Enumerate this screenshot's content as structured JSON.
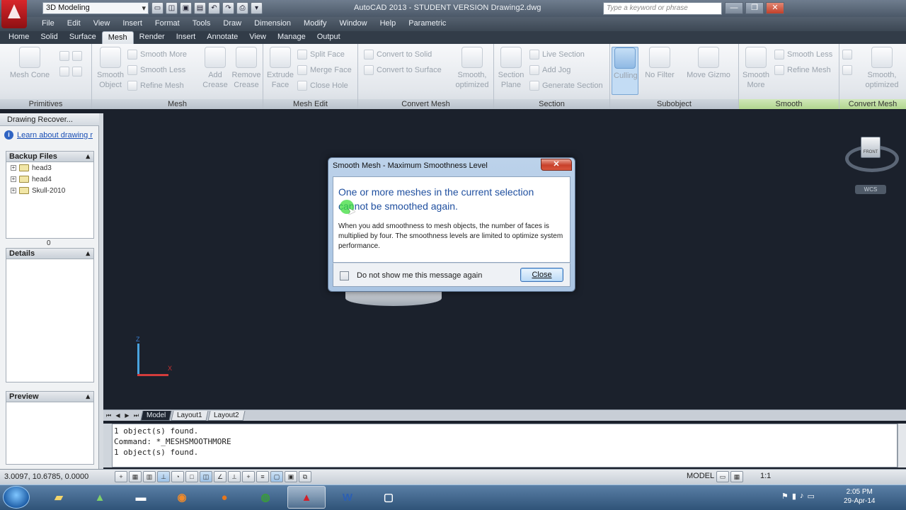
{
  "titlebar": {
    "workspace": "3D Modeling",
    "title": "AutoCAD 2013 - STUDENT VERSION   Drawing2.dwg",
    "search_placeholder": "Type a keyword or phrase",
    "min": "—",
    "max": "❐",
    "close": "✕"
  },
  "menu": [
    "File",
    "Edit",
    "View",
    "Insert",
    "Format",
    "Tools",
    "Draw",
    "Dimension",
    "Modify",
    "Window",
    "Help",
    "Parametric"
  ],
  "tabs": [
    "Home",
    "Solid",
    "Surface",
    "Mesh",
    "Render",
    "Insert",
    "Annotate",
    "View",
    "Manage",
    "Output"
  ],
  "active_tab": "Mesh",
  "ribbon": {
    "primitives": {
      "title": "Primitives",
      "mesh_cone": "Mesh Cone"
    },
    "mesh": {
      "title": "Mesh",
      "smooth_object": "Smooth Object",
      "smooth_more": "Smooth More",
      "smooth_less": "Smooth Less",
      "refine_mesh": "Refine Mesh"
    },
    "mesh_edit": {
      "title": "Mesh Edit",
      "add_crease": "Add Crease",
      "remove_crease": "Remove Crease",
      "extrude_face": "Extrude Face",
      "split_face": "Split Face",
      "merge_face": "Merge Face",
      "close_hole": "Close Hole"
    },
    "convert_mesh": {
      "title": "Convert Mesh",
      "convert_solid": "Convert to Solid",
      "convert_surface": "Convert to Surface",
      "smooth_optimized": "Smooth, optimized"
    },
    "section": {
      "title": "Section",
      "section_plane": "Section Plane",
      "live_section": "Live Section",
      "add_jog": "Add Jog",
      "generate_section": "Generate Section"
    },
    "subobject": {
      "title": "Subobject",
      "culling": "Culling",
      "no_filter": "No Filter",
      "move_gizmo": "Move Gizmo"
    },
    "smooth": {
      "title": "Smooth",
      "smooth_more": "Smooth More",
      "smooth_less": "Smooth Less",
      "refine_mesh": "Refine Mesh"
    },
    "convert_mesh2": {
      "title": "Convert Mesh",
      "smooth_optimized": "Smooth, optimized"
    }
  },
  "palette": {
    "title": "Drawing Recover...",
    "learn": "Learn about drawing r",
    "backup_files": "Backup Files",
    "files": [
      "head3",
      "head4",
      "Skull-2010"
    ],
    "count": "0",
    "details": "Details",
    "preview": "Preview"
  },
  "viewport": {
    "cube_face": "FRONT",
    "wcs": "WCS",
    "z": "Z",
    "x": "X"
  },
  "layout_tabs": [
    "Model",
    "Layout1",
    "Layout2"
  ],
  "command_lines": [
    "1 object(s) found.",
    "Command: *_MESHSMOOTHMORE",
    "1 object(s) found."
  ],
  "statusbar": {
    "coords": "3.0097, 10.6785, 0.0000",
    "model": "MODEL",
    "scale": "1:1"
  },
  "taskbar": {
    "time": "2:05 PM",
    "date": "29-Apr-14"
  },
  "dialog": {
    "title": "Smooth Mesh - Maximum Smoothness Level",
    "heading": "One or more meshes in the current selection cannot be smoothed again.",
    "body": "When you add smoothness to mesh objects, the number of faces is multiplied by four.  The smoothness levels are limited to optimize system performance.",
    "checkbox_label": "Do not show me this message again",
    "close_button": "Close",
    "close_x": "✕"
  }
}
